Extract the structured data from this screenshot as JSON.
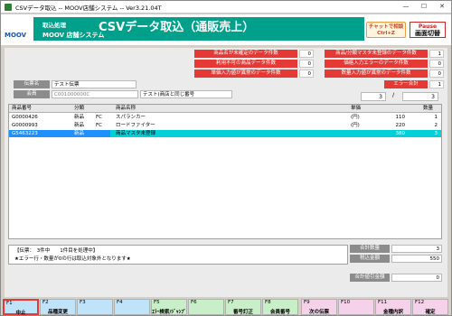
{
  "window": {
    "title": "CSVデータ取込 -- MOOV店舗システム -- Ver3.21.04T",
    "min": "—",
    "max": "☐",
    "close": "✕"
  },
  "header": {
    "logo": "MOOV",
    "section": "取込処理",
    "title": "CSVデータ取込（通販売上）",
    "system": "MOOV 店舗システム",
    "chat_line1": "チャットで相談",
    "chat_line2": "Ctrl+Z",
    "pause_line1": "Pause",
    "pause_line2": "画面切替"
  },
  "errors": {
    "left": [
      {
        "label": "商品名が未確定のデータ件数",
        "value": "0"
      },
      {
        "label": "利用不可の商品データ件数",
        "value": "0"
      },
      {
        "label": "単価入力値が異常のデータ件数",
        "value": "0"
      }
    ],
    "right": [
      {
        "label": "商品/分類マスタ未登録のデータ件数",
        "value": "1"
      },
      {
        "label": "価格入力エラーのデータ件数",
        "value": "0"
      },
      {
        "label": "数量入力値が異常のデータ件数",
        "value": "0"
      }
    ],
    "total_label": "エラー合計",
    "total_value": "1"
  },
  "slip": {
    "slip_label": "伝票名",
    "slip_value": "テスト伝票",
    "member_label": "会員",
    "member_code": "C001000000C",
    "member_name": "テスト(商店と同じ番号"
  },
  "pager": {
    "current": "3",
    "sep": "/",
    "total": "3"
  },
  "table": {
    "columns": [
      "商品番号",
      "分類",
      "商品名称",
      "単価",
      "数量"
    ],
    "rows": [
      {
        "code": "G0000426",
        "cls": "新品",
        "sub": "FC",
        "name": "スパランカー",
        "unit": "(円)",
        "price": "110",
        "qty": "1",
        "selected": false
      },
      {
        "code": "G0000993",
        "cls": "新品",
        "sub": "FC",
        "name": "ロードファイター",
        "unit": "(円)",
        "price": "220",
        "qty": "2",
        "selected": false
      },
      {
        "code": "G5463223",
        "cls": "新品",
        "sub": "",
        "name": "商品マスタ未登録",
        "unit": "",
        "price": "380",
        "qty": "3",
        "selected": true
      }
    ]
  },
  "message": {
    "line1": "【伝票：　3件中　　1件目を処理中】",
    "line2": "★エラー行・数量が0の行は取込対象外となります★"
  },
  "summary": {
    "qty_label": "合計数量",
    "qty_value": "3",
    "amount_label": "税込金額",
    "amount_value": "550",
    "adjust_label": "合計値引金額",
    "adjust_value": "0"
  },
  "fkeys": [
    {
      "key": "F1",
      "label": "中止",
      "color": "blue",
      "active": true
    },
    {
      "key": "F2",
      "label": "品種変更",
      "color": "blue"
    },
    {
      "key": "F3",
      "label": "",
      "color": "blue"
    },
    {
      "key": "F4",
      "label": "",
      "color": "blue"
    },
    {
      "key": "F5",
      "label": "ｴﾗｰ検索/ｼﾞｬﾝﾌﾟ",
      "color": "green"
    },
    {
      "key": "F6",
      "label": "",
      "color": "green"
    },
    {
      "key": "F7",
      "label": "番号訂正",
      "color": "green"
    },
    {
      "key": "F8",
      "label": "会員番号",
      "color": "green"
    },
    {
      "key": "F9",
      "label": "次の伝票",
      "color": "pink"
    },
    {
      "key": "F10",
      "label": "",
      "color": "pink"
    },
    {
      "key": "F11",
      "label": "金種内訳",
      "color": "pink"
    },
    {
      "key": "F12",
      "label": "確定",
      "color": "pink"
    }
  ],
  "colors": {
    "header": "#00a08a",
    "error": "#e53935",
    "selected_row": "#1e90ff",
    "selected_name": "#00d0d8"
  }
}
